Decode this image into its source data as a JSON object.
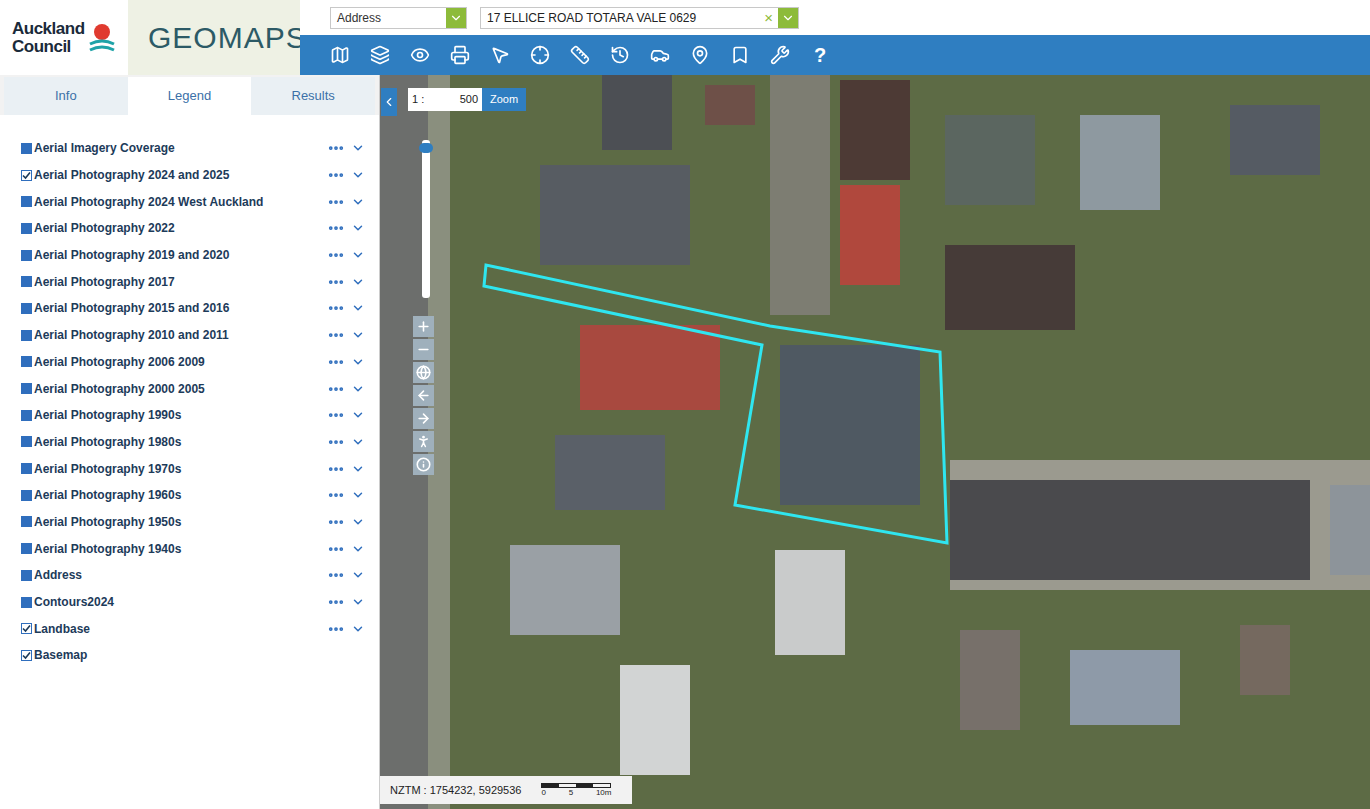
{
  "header": {
    "logo_line1": "Auckland",
    "logo_line2": "Council",
    "app_name": "GEOMAPS"
  },
  "search": {
    "type": "Address",
    "value": "17 ELLICE ROAD TOTARA VALE 0629",
    "clear": "×"
  },
  "toolbar": {
    "help": "?"
  },
  "tabs": [
    {
      "label": "Info",
      "selected": false
    },
    {
      "label": "Legend",
      "selected": true
    },
    {
      "label": "Results",
      "selected": false
    }
  ],
  "layers": [
    {
      "label": "Aerial Imagery Coverage",
      "checked": false,
      "has_menu": true
    },
    {
      "label": "Aerial Photography 2024 and 2025",
      "checked": true,
      "has_menu": true
    },
    {
      "label": "Aerial Photography 2024 West Auckland",
      "checked": false,
      "has_menu": true
    },
    {
      "label": "Aerial Photography 2022",
      "checked": false,
      "has_menu": true
    },
    {
      "label": "Aerial Photography 2019 and 2020",
      "checked": false,
      "has_menu": true
    },
    {
      "label": "Aerial Photography 2017",
      "checked": false,
      "has_menu": true
    },
    {
      "label": "Aerial Photography 2015 and 2016",
      "checked": false,
      "has_menu": true
    },
    {
      "label": "Aerial Photography 2010 and 2011",
      "checked": false,
      "has_menu": true
    },
    {
      "label": "Aerial Photography 2006 2009",
      "checked": false,
      "has_menu": true
    },
    {
      "label": "Aerial Photography 2000 2005",
      "checked": false,
      "has_menu": true
    },
    {
      "label": "Aerial Photography 1990s",
      "checked": false,
      "has_menu": true
    },
    {
      "label": "Aerial Photography 1980s",
      "checked": false,
      "has_menu": true
    },
    {
      "label": "Aerial Photography 1970s",
      "checked": false,
      "has_menu": true
    },
    {
      "label": "Aerial Photography 1960s",
      "checked": false,
      "has_menu": true
    },
    {
      "label": "Aerial Photography 1950s",
      "checked": false,
      "has_menu": true
    },
    {
      "label": "Aerial Photography 1940s",
      "checked": false,
      "has_menu": true
    },
    {
      "label": "Address",
      "checked": false,
      "has_menu": true
    },
    {
      "label": "Contours2024",
      "checked": false,
      "has_menu": true
    },
    {
      "label": "Landbase",
      "checked": true,
      "has_menu": true
    },
    {
      "label": "Basemap",
      "checked": true,
      "has_menu": false
    }
  ],
  "map": {
    "scale_prefix": "1 :",
    "scale_value": "500",
    "zoom_button": "Zoom",
    "zoom_level": 0.98,
    "coordinates": "NZTM : 1754232, 5929536",
    "scale_bar": [
      "0",
      "5",
      "10m"
    ]
  }
}
